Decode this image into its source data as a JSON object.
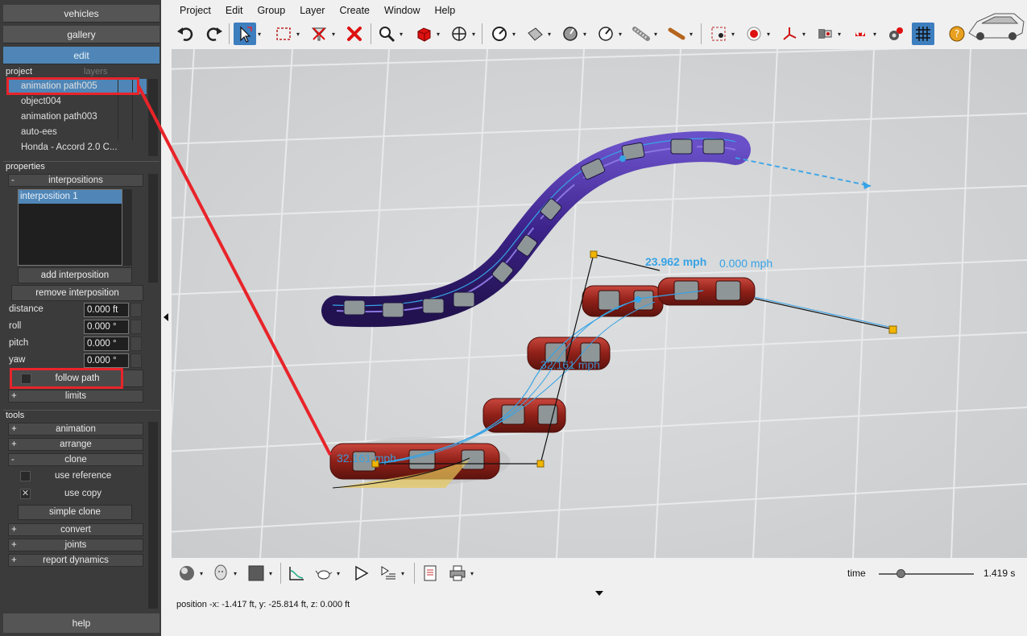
{
  "left_panel": {
    "vehicles": "vehicles",
    "gallery": "gallery",
    "edit": "edit",
    "project_tab": "project",
    "layers_tab": "layers",
    "project_items": [
      "animation path005",
      "object004",
      "animation path003",
      "auto-ees",
      "Honda - Accord 2.0 C..."
    ],
    "properties_header": "properties",
    "interpositions_label": "interpositions",
    "interpositions_list": [
      "interposition 1"
    ],
    "add_interposition": "add interposition",
    "remove_interposition": "remove interposition",
    "props": [
      {
        "label": "distance",
        "value": "0.000 ft"
      },
      {
        "label": "roll",
        "value": "0.000 °"
      },
      {
        "label": "pitch",
        "value": "0.000 °"
      },
      {
        "label": "yaw",
        "value": "0.000 °"
      }
    ],
    "follow_path": "follow path",
    "limits": "limits",
    "tools_header": "tools",
    "tools": {
      "animation": "animation",
      "arrange": "arrange",
      "clone": "clone",
      "use_reference": "use reference",
      "use_copy": "use copy",
      "simple_clone": "simple clone",
      "convert": "convert",
      "joints": "joints",
      "report_dynamics": "report dynamics"
    },
    "help": "help",
    "expand_sign": "+",
    "collapse_sign": "-",
    "checked_mark": "✕"
  },
  "menu": [
    "Project",
    "Edit",
    "Group",
    "Layer",
    "Create",
    "Window",
    "Help"
  ],
  "viewport": {
    "speed_labels": [
      "23.962 mph",
      "0.000 mph",
      "32.161 mph",
      "32.161 mph"
    ]
  },
  "status": {
    "position": "position -x: -1.417 ft, y: -25.814 ft, z: 0.000 ft",
    "time_label": "time",
    "time_value": "1.419 s",
    "time_fraction": 0.23
  },
  "colors": {
    "accent": "#4f86b7",
    "highlight_red": "#e8242a",
    "path_blue": "#36a3e6",
    "purple_car": "#4a2fa0",
    "red_car": "#9a2a22"
  }
}
